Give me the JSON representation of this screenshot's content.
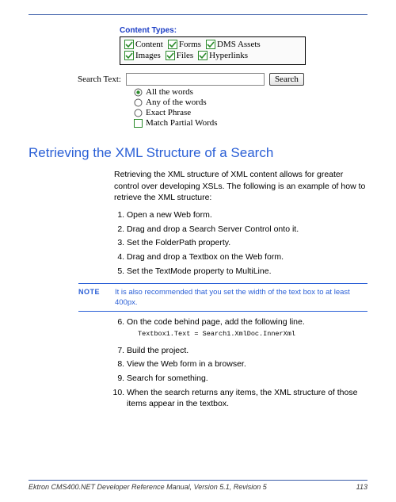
{
  "contentTypes": {
    "label": "Content Types:",
    "row1": [
      "Content",
      "Forms",
      "DMS Assets"
    ],
    "row2": [
      "Images",
      "Files",
      "Hyperlinks"
    ]
  },
  "search": {
    "label": "Search Text:",
    "button": "Search"
  },
  "options": {
    "all": "All the words",
    "any": "Any of the words",
    "exact": "Exact Phrase",
    "partial": "Match Partial Words"
  },
  "heading": "Retrieving the XML Structure of a Search",
  "intro": "Retrieving the XML structure of XML content allows for greater control over developing XSLs. The following is an example of how to retrieve the XML structure:",
  "steps1": [
    "Open a new Web form.",
    "Drag and drop a Search Server Control onto it.",
    "Set the FolderPath property.",
    "Drag and drop a Textbox on the Web form.",
    "Set the TextMode property to MultiLine."
  ],
  "noteLabel": "NOTE",
  "noteText": "It is also recommended that you set the width of the text box to at least 400px.",
  "step6": "On the code behind page, add the following line.",
  "code": "Textbox1.Text = Search1.XmlDoc.InnerXml",
  "steps2": [
    "Build the project.",
    "View the Web form in a browser.",
    "Search for something.",
    "When the search returns any items, the XML structure of those items appear in the textbox."
  ],
  "footer": {
    "left": "Ektron CMS400.NET Developer Reference Manual, Version 5.1, Revision 5",
    "right": "113"
  }
}
